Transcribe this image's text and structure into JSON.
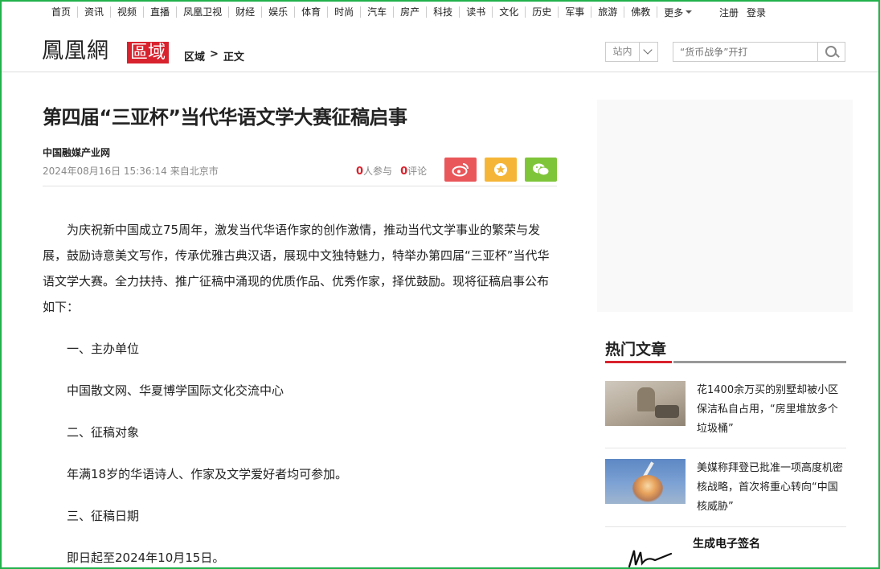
{
  "topnav": {
    "items": [
      "首页",
      "资讯",
      "视频",
      "直播",
      "凤凰卫视",
      "财经",
      "娱乐",
      "体育",
      "时尚",
      "汽车",
      "房产",
      "科技",
      "读书",
      "文化",
      "历史",
      "军事",
      "旅游",
      "佛教"
    ],
    "more": "更多",
    "register": "注册",
    "login": "登录"
  },
  "header": {
    "logo": "鳳凰網",
    "region_badge": "區域",
    "breadcrumb": [
      "区域",
      ">",
      "正文"
    ],
    "site_select": "站内",
    "search_placeholder": "“货币战争”开打"
  },
  "article": {
    "title": "第四届“三亚杯”当代华语文学大赛征稿启事",
    "source": "中国融媒产业网",
    "datetime": "2024年08月16日 15:36:14",
    "location": "来自北京市",
    "participants_count": "0",
    "participants_label": "人参与",
    "comments_count": "0",
    "comments_label": "评论",
    "paragraphs": [
      "为庆祝新中国成立75周年，激发当代华语作家的创作激情，推动当代文学事业的繁荣与发展，鼓励诗意美文写作，传承优雅古典汉语，展现中文独特魅力，特举办第四届“三亚杯”当代华语文学大赛。全力扶持、推广征稿中涌现的优质作品、优秀作家，择优鼓励。现将征稿启事公布如下：",
      "一、主办单位",
      "中国散文网、华夏博学国际文化交流中心",
      "二、征稿对象",
      "年满18岁的华语诗人、作家及文学爱好者均可参加。",
      "三、征稿日期",
      "即日起至2024年10月15日。"
    ]
  },
  "sidebar": {
    "hot_title": "热门文章",
    "hot_items": [
      {
        "title": "花1400余万买的别墅却被小区保洁私自占用，“房里堆放多个垃圾桶”"
      },
      {
        "title": "美媒称拜登已批准一项高度机密核战略，首次将重心转向“中国核威胁”"
      }
    ],
    "signature_title": "生成电子签名"
  },
  "colors": {
    "accent_red": "#d8222d",
    "weibo": "#e9575a",
    "favorite": "#f5b638",
    "wechat": "#7fc53a",
    "frame_green": "#22b14c"
  }
}
